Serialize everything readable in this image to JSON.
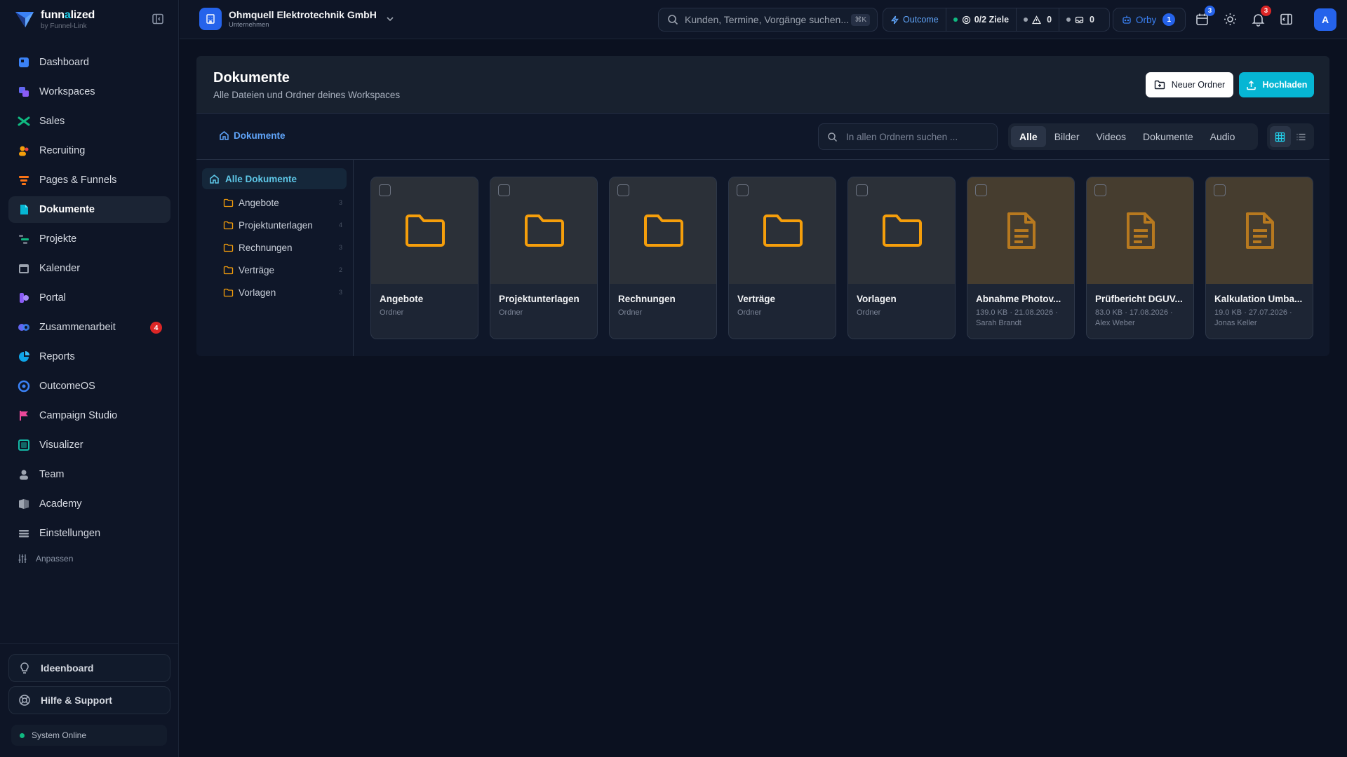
{
  "brand": {
    "name_pre": "funn",
    "name_accent": "a",
    "name_post": "lized",
    "subtitle": "by Funnel-Link"
  },
  "sidebar": {
    "items": [
      {
        "label": "Dashboard",
        "icon": "dashboard-icon",
        "color": "#3b82f6"
      },
      {
        "label": "Workspaces",
        "icon": "workspaces-icon",
        "color": "#6366f1"
      },
      {
        "label": "Sales",
        "icon": "sales-icon",
        "color": "#10b981"
      },
      {
        "label": "Recruiting",
        "icon": "recruiting-icon",
        "color": "#f59e0b"
      },
      {
        "label": "Pages & Funnels",
        "icon": "funnel-icon",
        "color": "#f97316"
      },
      {
        "label": "Dokumente",
        "icon": "documents-icon",
        "color": "#06b6d4",
        "active": true
      },
      {
        "label": "Projekte",
        "icon": "projects-icon",
        "color": "#10b981"
      },
      {
        "label": "Kalender",
        "icon": "calendar-icon",
        "color": "#9ca3af"
      },
      {
        "label": "Portal",
        "icon": "portal-icon",
        "color": "#8b5cf6"
      },
      {
        "label": "Zusammenarbeit",
        "icon": "collaboration-icon",
        "color": "#6366f1",
        "badge": "4"
      },
      {
        "label": "Reports",
        "icon": "reports-icon",
        "color": "#0ea5e9"
      },
      {
        "label": "OutcomeOS",
        "icon": "outcome-icon",
        "color": "#3b82f6"
      },
      {
        "label": "Campaign Studio",
        "icon": "flag-icon",
        "color": "#ec4899"
      },
      {
        "label": "Visualizer",
        "icon": "visualizer-icon",
        "color": "#14b8a6"
      },
      {
        "label": "Team",
        "icon": "team-icon",
        "color": "#9ca3af"
      },
      {
        "label": "Academy",
        "icon": "academy-icon",
        "color": "#9ca3af"
      },
      {
        "label": "Einstellungen",
        "icon": "settings-icon",
        "color": "#9ca3af"
      }
    ],
    "customize_label": "Anpassen",
    "ideaboard_label": "Ideenboard",
    "help_label": "Hilfe & Support",
    "status_label": "System Online"
  },
  "topbar": {
    "company_name": "Ohmquell Elektrotechnik GmbH",
    "company_type": "Unternehmen",
    "search_placeholder": "Kunden, Termine, Vorgänge suchen...",
    "search_shortcut": "⌘K",
    "outcome_label": "Outcome",
    "goals_label": "0/2 Ziele",
    "alerts_count": "0",
    "mail_count": "0",
    "orby_label": "Orby",
    "orby_badge": "1",
    "calendar_badge": "3",
    "notifications_badge": "3",
    "avatar_initial": "A"
  },
  "documents": {
    "title": "Dokumente",
    "subtitle": "Alle Dateien und Ordner deines Workspaces",
    "new_folder_label": "Neuer Ordner",
    "upload_label": "Hochladen",
    "breadcrumb": "Dokumente",
    "search_placeholder": "In allen Ordnern suchen ...",
    "filters": [
      "Alle",
      "Bilder",
      "Videos",
      "Dokumente",
      "Audio"
    ],
    "active_filter": "Alle",
    "view_mode": "grid",
    "tree": {
      "root": "Alle Dokumente",
      "folders": [
        {
          "name": "Angebote",
          "count": "3"
        },
        {
          "name": "Projektunterlagen",
          "count": "4"
        },
        {
          "name": "Rechnungen",
          "count": "3"
        },
        {
          "name": "Verträge",
          "count": "2"
        },
        {
          "name": "Vorlagen",
          "count": "3"
        }
      ]
    },
    "items": [
      {
        "type": "folder",
        "name": "Angebote",
        "meta1": "Ordner",
        "meta2": ""
      },
      {
        "type": "folder",
        "name": "Projektunterlagen",
        "meta1": "Ordner",
        "meta2": ""
      },
      {
        "type": "folder",
        "name": "Rechnungen",
        "meta1": "Ordner",
        "meta2": ""
      },
      {
        "type": "folder",
        "name": "Verträge",
        "meta1": "Ordner",
        "meta2": ""
      },
      {
        "type": "folder",
        "name": "Vorlagen",
        "meta1": "Ordner",
        "meta2": ""
      },
      {
        "type": "file",
        "name": "Abnahme Photov...",
        "meta1": "139.0 KB · 21.08.2026 ·",
        "meta2": "Sarah Brandt"
      },
      {
        "type": "file",
        "name": "Prüfbericht DGUV...",
        "meta1": "83.0 KB · 17.08.2026 ·",
        "meta2": "Alex Weber"
      },
      {
        "type": "file",
        "name": "Kalkulation Umba...",
        "meta1": "19.0 KB · 27.07.2026 ·",
        "meta2": "Jonas Keller"
      }
    ]
  },
  "colors": {
    "accent": "#06b6d4",
    "folder": "#f59e0b",
    "file_icon": "#b7791f",
    "badge_red": "#dc2626",
    "primary_blue": "#2563eb"
  }
}
